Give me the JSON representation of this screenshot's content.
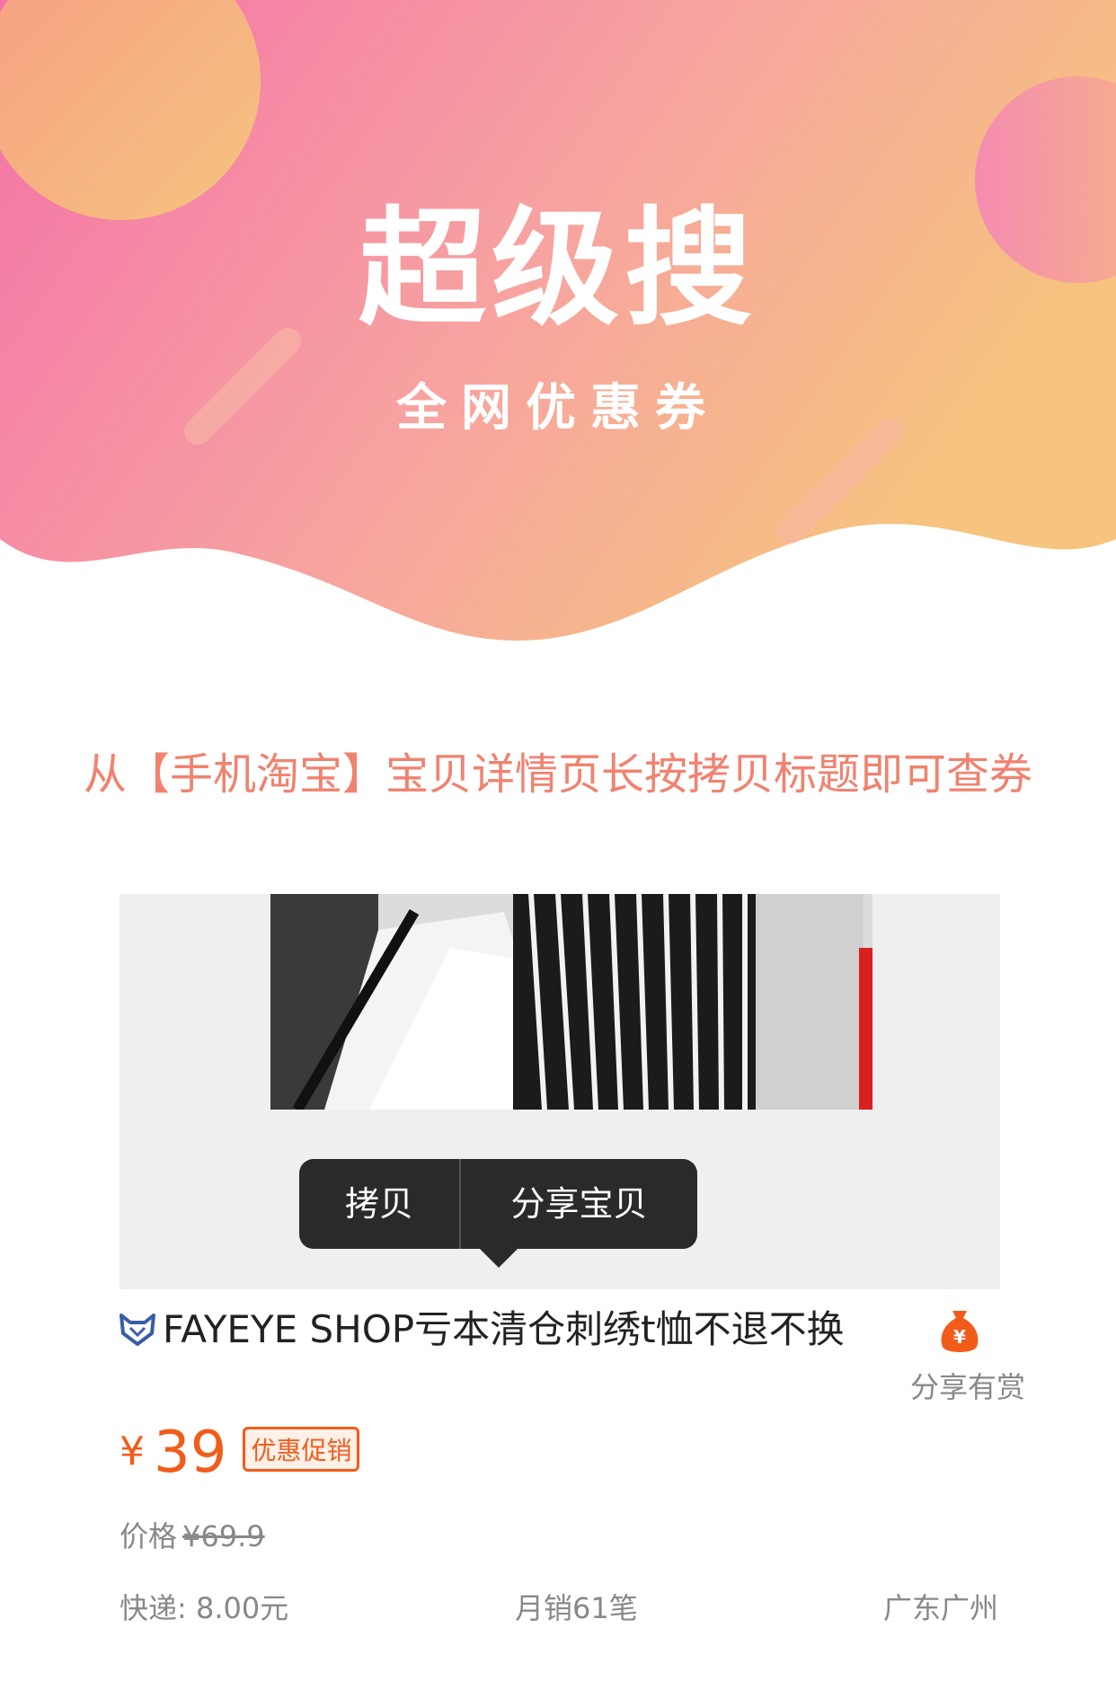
{
  "hero": {
    "title": "超级搜",
    "subtitle": "全网优惠券"
  },
  "instruction": "从【手机淘宝】宝贝详情页长按拷贝标题即可查券",
  "popup": {
    "copy_label": "拷贝",
    "share_label": "分享宝贝"
  },
  "product": {
    "title": "FAYEYE SHOP亏本清仓刺绣t恤不退不换",
    "currency_symbol": "¥",
    "price": "39",
    "promo_tag": "优惠促销",
    "original_price_label": "价格",
    "original_price": "¥69.9",
    "shipping": "快递: 8.00元",
    "monthly_sales": "月销61笔",
    "location": "广东广州"
  },
  "share": {
    "label": "分享有赏",
    "icon": "money-bag-icon"
  },
  "colors": {
    "gradient_start": "#f472a8",
    "gradient_end": "#f6c47e",
    "instruction_text": "#f0826f",
    "price": "#f25c1a"
  }
}
